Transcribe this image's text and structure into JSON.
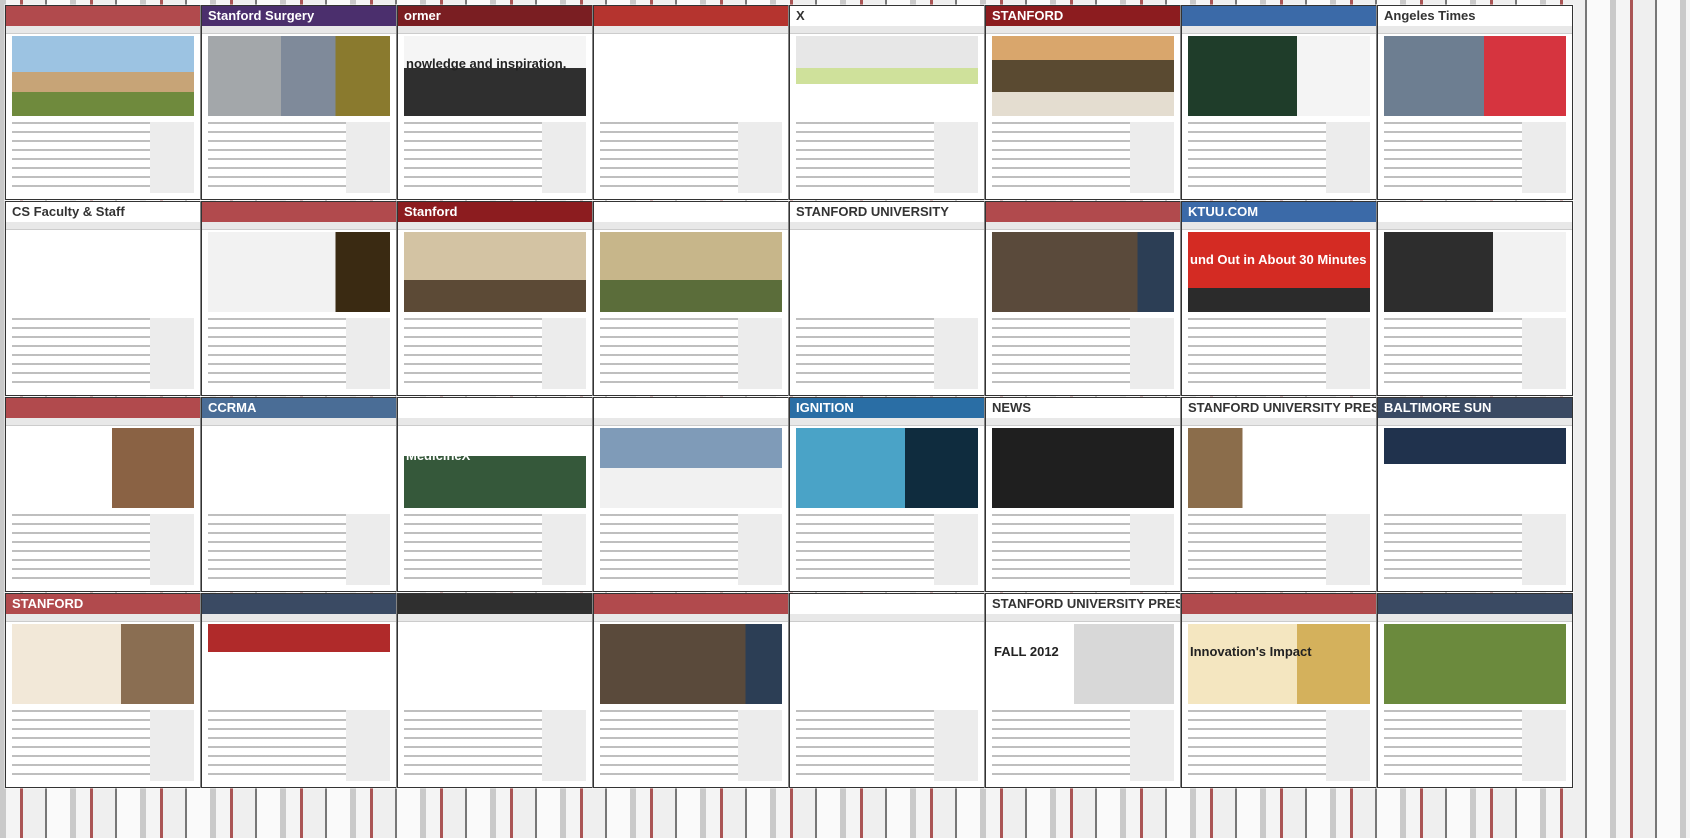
{
  "tiles": [
    {
      "bar": "#b14a4d",
      "hero": "linear-gradient(180deg,#9cc3e2 0 45%,#c7a477 45% 70%,#6f8a3d 70%)",
      "logo": ""
    },
    {
      "bar": "#4b2f6d",
      "hero": "linear-gradient(90deg,#a3a7aa 0 40%,#7f8a9a 40% 70%,#8a7a2e 70%)",
      "logo": "Stanford Surgery"
    },
    {
      "bar": "#7a1e22",
      "hero": "linear-gradient(180deg,#f5f5f5 0 40%,#2f2f2f 40%)",
      "logo": "ormer",
      "big": "nowledge and inspiration,"
    },
    {
      "bar": "#b5342f",
      "hero": "linear-gradient(180deg,#ffffff 0 100%)",
      "logo": ""
    },
    {
      "bar": "#ffffff",
      "hero": "linear-gradient(180deg,#e7e7e7 0 40%,#cfe19b 40% 60%,#ffffff 60%)",
      "logo": "X"
    },
    {
      "bar": "#8c1c1f",
      "hero": "linear-gradient(180deg,#d9a66c 0 30%,#5a4a31 30% 70%,#e4ddd0 70%)",
      "logo": "STANFORD"
    },
    {
      "bar": "#3b6aa8",
      "hero": "linear-gradient(90deg,#1f3d2a 0 60%,#f4f4f4 60%)",
      "logo": ""
    },
    {
      "bar": "#ffffff",
      "hero": "linear-gradient(90deg,#6d7e91 0 55%,#d6343f 55%)",
      "logo": "Angeles Times"
    },
    {
      "bar": "#ffffff",
      "hero": "linear-gradient(180deg,#ffffff 0 100%)",
      "logo": "CS Faculty & Staff"
    },
    {
      "bar": "#b14a4d",
      "hero": "linear-gradient(90deg,#f2f2f2 0 70%,#3a2a12 70%)",
      "logo": ""
    },
    {
      "bar": "#8c1c1f",
      "hero": "linear-gradient(180deg,#d3c3a3 0 60%,#5c4a36 60%)",
      "logo": "Stanford"
    },
    {
      "bar": "#ffffff",
      "hero": "linear-gradient(180deg,#c7b68a 0 60%,#5b6d3a 60%)",
      "logo": ""
    },
    {
      "bar": "#ffffff",
      "hero": "linear-gradient(180deg,#ffffff 0 100%)",
      "logo": "STANFORD UNIVERSITY"
    },
    {
      "bar": "#b14a4d",
      "hero": "linear-gradient(90deg,#5a4a3b 0 80%,#2c3e55 80%)",
      "logo": ""
    },
    {
      "bar": "#3b6aa8",
      "hero": "linear-gradient(180deg,#d42b23 0 70%,#2b2b2b 70%)",
      "logo": "KTUU.COM",
      "big": "und Out in About 30 Minutes"
    },
    {
      "bar": "#ffffff",
      "hero": "linear-gradient(90deg,#2d2d2d 0 60%,#f2f2f2 60%)",
      "logo": ""
    },
    {
      "bar": "#b14a4d",
      "hero": "linear-gradient(90deg,#ffffff 0 55%,#8a6244 55%)",
      "logo": ""
    },
    {
      "bar": "#4a6d96",
      "hero": "linear-gradient(180deg,#ffffff 0 100%)",
      "logo": "CCRMA"
    },
    {
      "bar": "#ffffff",
      "hero": "linear-gradient(180deg,#ffffff 0 35%,#35583a 35%)",
      "logo": "",
      "big": "MedicineX"
    },
    {
      "bar": "#ffffff",
      "hero": "linear-gradient(180deg,#7f9bb8 0 50%,#f1f1f1 50%)",
      "logo": ""
    },
    {
      "bar": "#2a6ea5",
      "hero": "linear-gradient(90deg,#4aa3c7 0 60%,#0f2c3e 60%)",
      "logo": "IGNITION"
    },
    {
      "bar": "#ffffff",
      "hero": "linear-gradient(180deg,#1f1f1f 0 100%)",
      "logo": "NEWS"
    },
    {
      "bar": "#ffffff",
      "hero": "linear-gradient(90deg,#8b6d4b 0 30%,#ffffff 30%)",
      "logo": "STANFORD UNIVERSITY PRESS"
    },
    {
      "bar": "#3a4a63",
      "hero": "linear-gradient(180deg,#20324d 0 45%,#ffffff 45%)",
      "logo": "BALTIMORE SUN"
    },
    {
      "bar": "#b14a4d",
      "hero": "linear-gradient(90deg,#f2e8d8 0 60%,#8a6e52 60%)",
      "logo": "STANFORD"
    },
    {
      "bar": "#3a4a63",
      "hero": "linear-gradient(180deg,#b02a2a 0 35%,#ffffff 35%)",
      "logo": ""
    },
    {
      "bar": "#2f2f2f",
      "hero": "linear-gradient(180deg,#ffffff 0 100%)",
      "logo": ""
    },
    {
      "bar": "#b14a4d",
      "hero": "linear-gradient(90deg,#5a4a3b 0 80%,#2c3e55 80%)",
      "logo": ""
    },
    {
      "bar": "#ffffff",
      "hero": "linear-gradient(180deg,#ffffff 0 100%)",
      "logo": ""
    },
    {
      "bar": "#ffffff",
      "hero": "linear-gradient(90deg,#ffffff 0 45%,#d8d8d8 45%)",
      "logo": "STANFORD UNIVERSITY PRESS",
      "big": "FALL 2012"
    },
    {
      "bar": "#b14a4d",
      "hero": "linear-gradient(90deg,#f4e6c0 0 60%,#d4b15c 60%)",
      "logo": "",
      "big": "Innovation's Impact"
    },
    {
      "bar": "#3a4a63",
      "hero": "linear-gradient(180deg,#6b8a3d 0 100%)",
      "logo": ""
    }
  ]
}
